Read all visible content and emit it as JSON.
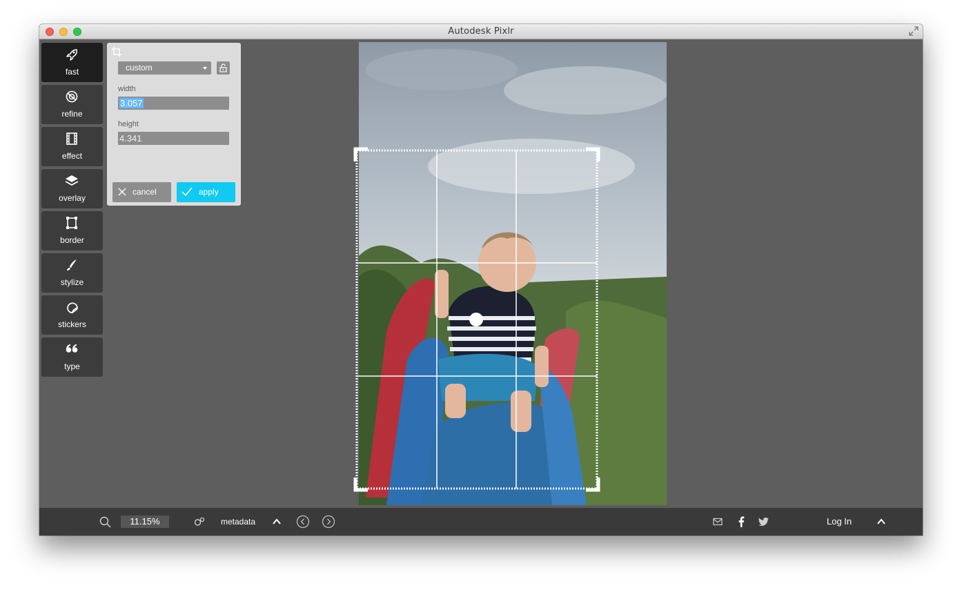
{
  "window": {
    "title": "Autodesk Pixlr"
  },
  "tools": [
    {
      "label": "fast",
      "icon": "rocket-icon",
      "active": true
    },
    {
      "label": "refine",
      "icon": "refine-icon"
    },
    {
      "label": "effect",
      "icon": "film-icon"
    },
    {
      "label": "overlay",
      "icon": "layers-icon"
    },
    {
      "label": "border",
      "icon": "border-icon"
    },
    {
      "label": "stylize",
      "icon": "brush-icon"
    },
    {
      "label": "stickers",
      "icon": "sticker-icon"
    },
    {
      "label": "type",
      "icon": "quote-icon"
    }
  ],
  "crop": {
    "preset": "custom",
    "width_label": "width",
    "width_value": "3.057",
    "height_label": "height",
    "height_value": "4.341",
    "cancel_label": "cancel",
    "apply_label": "apply"
  },
  "bottom": {
    "zoom": "11.15%",
    "metadata_label": "metadata",
    "login_label": "Log In"
  },
  "colors": {
    "accent": "#12c9f1",
    "panel": "#dcdcdc",
    "workspace": "#5e5e5e",
    "toolbar": "#3a3a3a"
  }
}
